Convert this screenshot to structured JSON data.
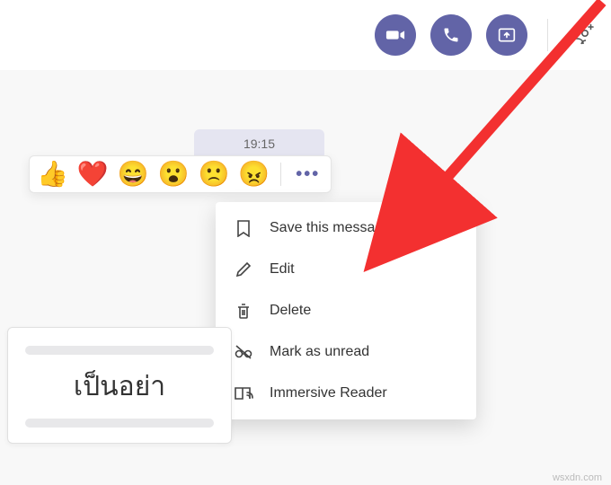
{
  "colors": {
    "accent": "#6264a7",
    "arrow": "#f33030"
  },
  "header": {
    "buttons": {
      "video": "video",
      "call": "call",
      "screenshare": "screenshare"
    }
  },
  "message": {
    "timestamp": "19:15"
  },
  "reactions": {
    "like": "👍",
    "heart": "❤️",
    "laugh": "😄",
    "surprised": "😮",
    "sad": "🙁",
    "angry": "😠"
  },
  "menu": {
    "save": "Save this message",
    "edit": "Edit",
    "delete": "Delete",
    "mark_unread": "Mark as unread",
    "immersive": "Immersive Reader"
  },
  "compose": {
    "text": "เป็นอย่า"
  },
  "watermark": "wsxdn.com"
}
